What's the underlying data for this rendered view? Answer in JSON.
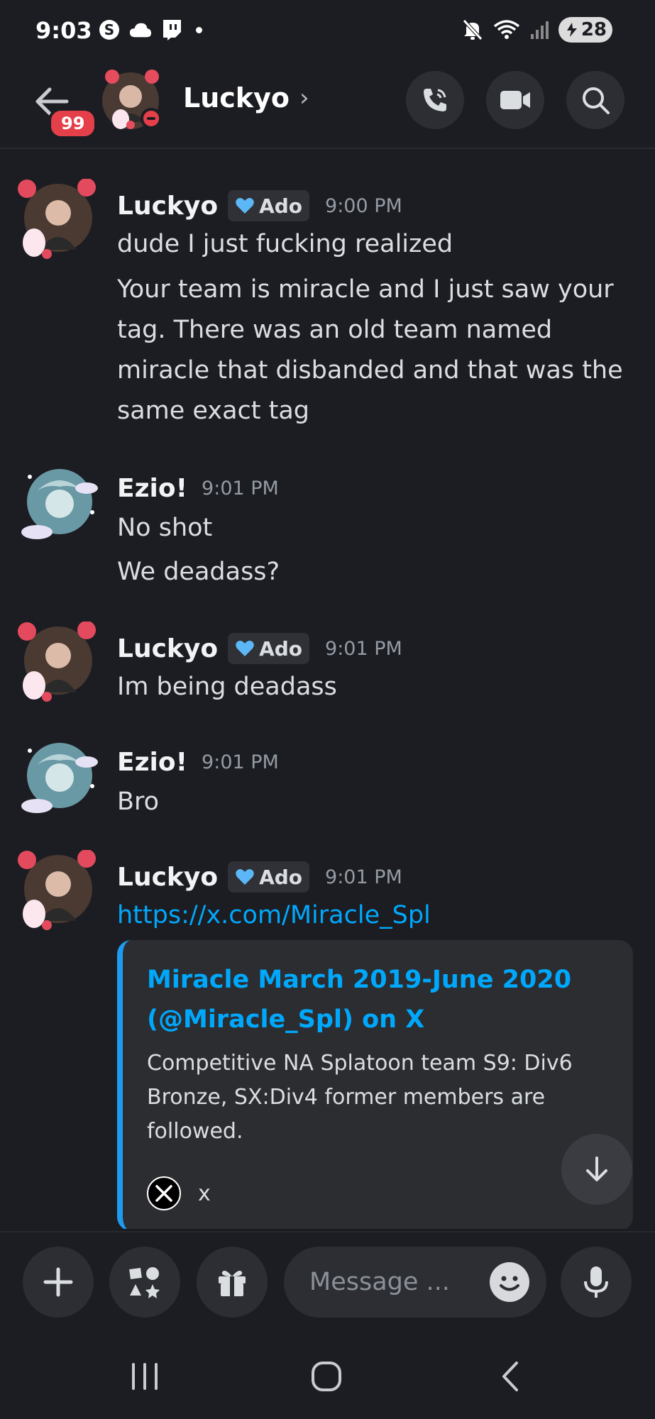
{
  "status_bar": {
    "time": "9:03",
    "battery": "28"
  },
  "header": {
    "unread_badge": "99",
    "channel_name": "Luckyo"
  },
  "messages": [
    {
      "author": "Luckyo",
      "tag": "Ado",
      "timestamp": "9:00 PM",
      "lines": [
        "dude I just fucking realized",
        "Your team is miracle and I just saw your",
        "tag. There was an old team named",
        "miracle that disbanded and that was the",
        "same exact tag"
      ]
    },
    {
      "author": "Ezio!",
      "timestamp": "9:01 PM",
      "lines": [
        "No shot",
        "We deadass?"
      ]
    },
    {
      "author": "Luckyo",
      "tag": "Ado",
      "timestamp": "9:01 PM",
      "lines": [
        "Im being deadass"
      ]
    },
    {
      "author": "Ezio!",
      "timestamp": "9:01 PM",
      "lines": [
        "Bro"
      ]
    },
    {
      "author": "Luckyo",
      "tag": "Ado",
      "timestamp": "9:01 PM",
      "link": "https://x.com/Miracle_Spl"
    }
  ],
  "embed": {
    "title_line1": "Miracle March 2019-June 2020",
    "title_line2": "(@Miracle_Spl) on X",
    "description_lines": [
      "Competitive NA Splatoon team S9: Div6",
      "Bronze, SX:Div4 former members are",
      "followed."
    ],
    "footer": "x"
  },
  "composer": {
    "placeholder": "Message ..."
  },
  "colors": {
    "background": "#1c1d22",
    "link": "#00a8fc",
    "embed_accent": "#1d9bf0",
    "badge": "#e5404a"
  }
}
